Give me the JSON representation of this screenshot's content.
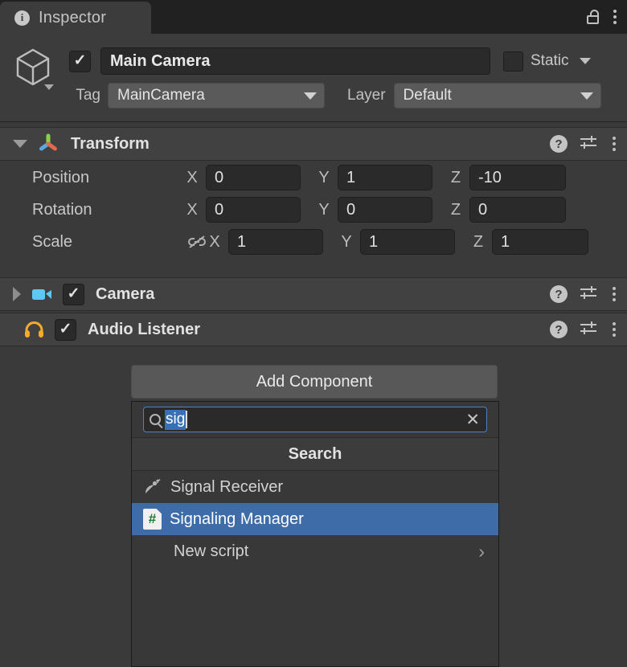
{
  "window": {
    "tab_label": "Inspector",
    "tab_icon": "info-icon",
    "lock_icon": "lock-open-icon",
    "menu_icon": "kebab-menu-icon"
  },
  "object_header": {
    "object_icon": "gameobject-cube-icon",
    "enabled_checkbox": true,
    "name": "Main Camera",
    "static_label": "Static",
    "static_checked": false,
    "tag_label": "Tag",
    "tag_value": "MainCamera",
    "layer_label": "Layer",
    "layer_value": "Default"
  },
  "components": [
    {
      "name": "Transform",
      "icon": "transform-axis-icon",
      "expanded": true,
      "has_checkbox": false,
      "help_icon": "help-icon",
      "preset_icon": "preset-sliders-icon",
      "menu_icon": "kebab-menu-icon",
      "rows": [
        {
          "label": "Position",
          "x": "0",
          "y": "1",
          "z": "-10",
          "link": false
        },
        {
          "label": "Rotation",
          "x": "0",
          "y": "0",
          "z": "0",
          "link": false
        },
        {
          "label": "Scale",
          "x": "1",
          "y": "1",
          "z": "1",
          "link": true
        }
      ],
      "axis_labels": {
        "x": "X",
        "y": "Y",
        "z": "Z"
      },
      "scale_link_icon": "link-broken-icon"
    },
    {
      "name": "Camera",
      "icon": "camera-icon",
      "expanded": false,
      "has_checkbox": true,
      "checked": true,
      "help_icon": "help-icon",
      "preset_icon": "preset-sliders-icon",
      "menu_icon": "kebab-menu-icon"
    },
    {
      "name": "Audio Listener",
      "icon": "headphones-icon",
      "expanded": false,
      "has_checkbox": true,
      "checked": true,
      "help_icon": "help-icon",
      "preset_icon": "preset-sliders-icon",
      "menu_icon": "kebab-menu-icon"
    }
  ],
  "add_component": {
    "button_label": "Add Component",
    "search": {
      "icon": "search-icon",
      "value": "sig",
      "selected": true,
      "clear_icon": "clear-x-icon"
    },
    "results_header": "Search",
    "results": [
      {
        "label": "Signal Receiver",
        "icon": "satellite-dish-icon",
        "selected": false,
        "has_chevron": false
      },
      {
        "label": "Signaling Manager",
        "icon": "csharp-script-icon",
        "selected": true,
        "has_chevron": false
      },
      {
        "label": "New script",
        "icon": "none",
        "selected": false,
        "has_chevron": true
      }
    ]
  },
  "colors": {
    "selection_blue": "#3d6ca8",
    "focus_border": "#4a84c8",
    "camera_icon": "#5ec8f0",
    "headphones_icon": "#f5ab2a",
    "script_hash_green": "#1b7a2e",
    "axis_x": "#e06a4e",
    "axis_y": "#8ad24b",
    "axis_z": "#5aa9e0"
  }
}
